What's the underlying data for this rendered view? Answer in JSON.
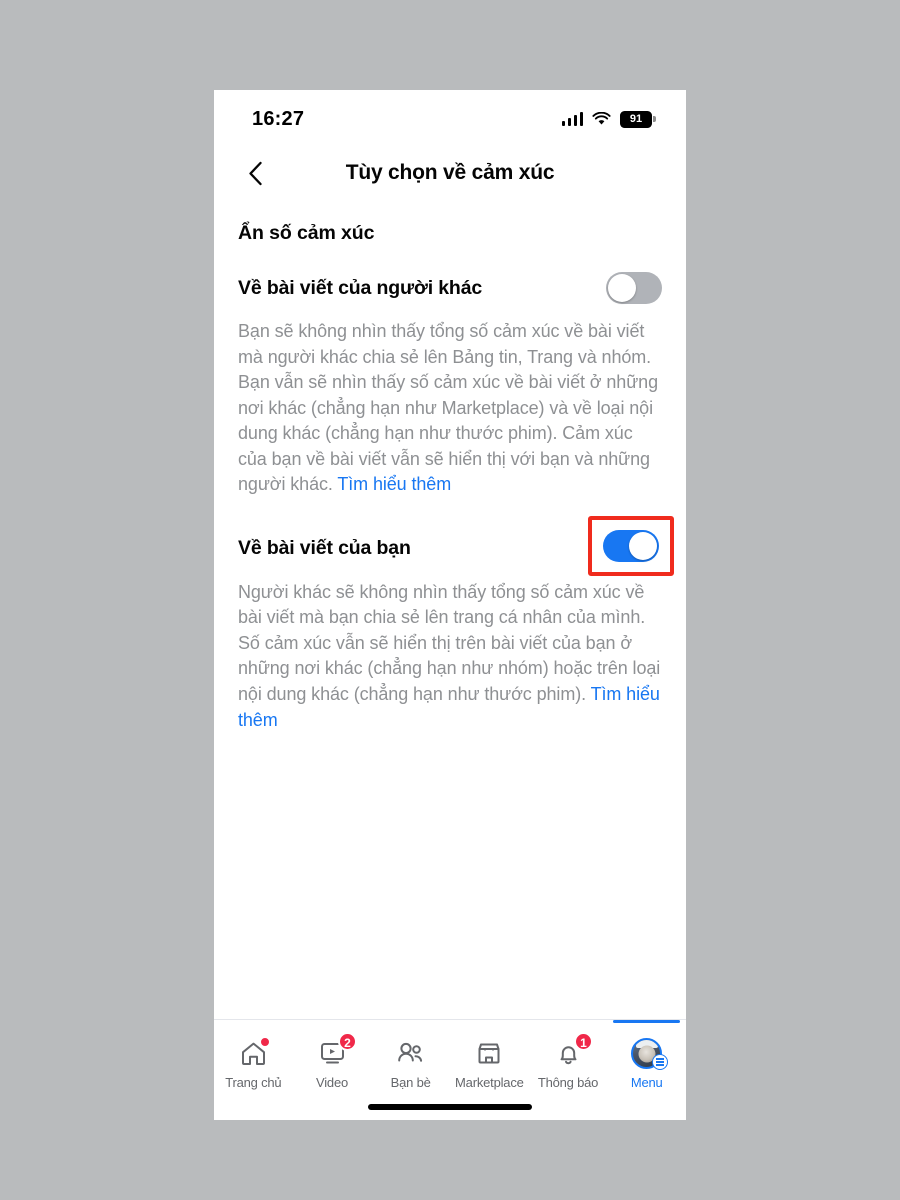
{
  "status_bar": {
    "time": "16:27",
    "signal_icon": "cellular-signal-icon",
    "wifi_icon": "wifi-icon",
    "battery_level": "91"
  },
  "header": {
    "back_icon": "back-chevron-icon",
    "title": "Tùy chọn về cảm xúc"
  },
  "main": {
    "section_title": "Ẩn số cảm xúc",
    "settings": [
      {
        "label": "Về bài viết của người khác",
        "toggle_state": "off",
        "description": "Bạn sẽ không nhìn thấy tổng số cảm xúc về bài viết mà người khác chia sẻ lên Bảng tin, Trang và nhóm. Bạn vẫn sẽ nhìn thấy số cảm xúc về bài viết ở những nơi khác (chẳng hạn như Marketplace) và về loại nội dung khác (chẳng hạn như thước phim). Cảm xúc của bạn về bài viết vẫn sẽ hiển thị với bạn và những người khác. ",
        "link_label": "Tìm hiểu thêm",
        "highlighted": false
      },
      {
        "label": "Về bài viết của bạn",
        "toggle_state": "on",
        "description": "Người khác sẽ không nhìn thấy tổng số cảm xúc về bài viết mà bạn chia sẻ lên trang cá nhân của mình. Số cảm xúc vẫn sẽ hiển thị trên bài viết của bạn ở những nơi khác (chẳng hạn như nhóm) hoặc trên loại nội dung khác (chẳng hạn như thước phim). ",
        "link_label": "Tìm hiểu thêm",
        "highlighted": true
      }
    ]
  },
  "bottom_nav": {
    "tabs": [
      {
        "label": "Trang chủ",
        "icon": "home-icon",
        "badge": "",
        "dot": true,
        "active": false
      },
      {
        "label": "Video",
        "icon": "video-icon",
        "badge": "2",
        "dot": false,
        "active": false
      },
      {
        "label": "Bạn bè",
        "icon": "friends-icon",
        "badge": "",
        "dot": false,
        "active": false
      },
      {
        "label": "Marketplace",
        "icon": "marketplace-icon",
        "badge": "",
        "dot": false,
        "active": false
      },
      {
        "label": "Thông báo",
        "icon": "bell-icon",
        "badge": "1",
        "dot": false,
        "active": false
      },
      {
        "label": "Menu",
        "icon": "avatar-menu-icon",
        "badge": "",
        "dot": false,
        "active": true
      }
    ]
  },
  "colors": {
    "accent": "#1877f2",
    "badge_red": "#f02849",
    "highlight_red": "#f02b1d",
    "text_primary": "#050505",
    "text_secondary": "#8e9093",
    "toggle_off": "#b0b3b8"
  }
}
